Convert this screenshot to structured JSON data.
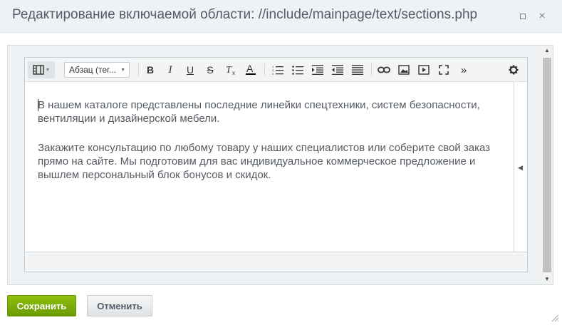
{
  "window": {
    "title": "Редактирование включаемой области: //include/mainpage/text/sections.php",
    "maximize_label": "",
    "close_label": "×"
  },
  "toolbar": {
    "style_select_value": "Абзац (тег...",
    "bold_label": "B",
    "italic_label": "I",
    "underline_label": "U",
    "strike_label": "S",
    "more_label": "»"
  },
  "content": {
    "paragraphs": [
      "В нашем каталоге представлены последние линейки спецтехники, систем безопасности, вентиляции и дизайнерской мебели.",
      "Закажите консультацию по любому товару у наших специалистов или соберите свой заказ прямо на сайте. Мы подготовим для вас индивидуальное коммерческое предложение и вышлем персональный блок бонусов и скидок."
    ]
  },
  "buttons": {
    "save_label": "Сохранить",
    "cancel_label": "Отменить"
  },
  "colors": {
    "accent_green": "#7eb00a",
    "title_text": "#535c69"
  }
}
